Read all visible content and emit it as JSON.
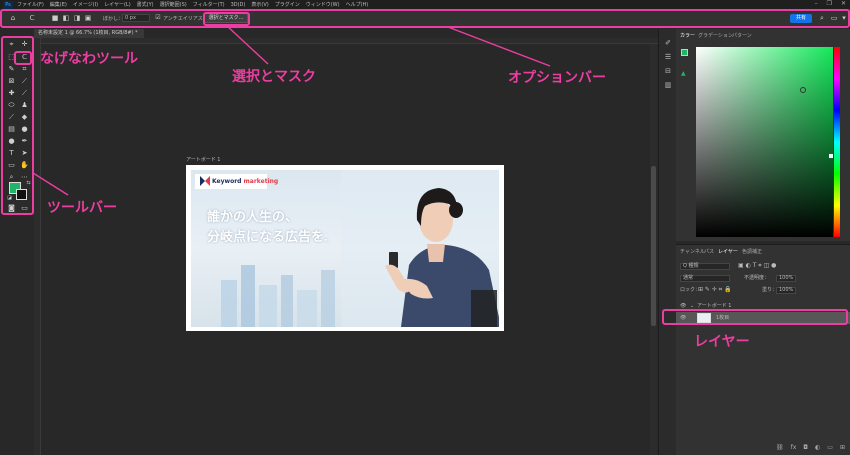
{
  "app": {
    "logo": "Ps"
  },
  "menu": {
    "items": [
      "ファイル(F)",
      "編集(E)",
      "イメージ(I)",
      "レイヤー(L)",
      "書式(Y)",
      "選択範囲(S)",
      "フィルター(T)",
      "3D(D)",
      "表示(V)",
      "プラグイン",
      "ウィンドウ(W)",
      "ヘルプ(H)"
    ],
    "window_controls": [
      "–",
      "❐",
      "✕"
    ]
  },
  "options": {
    "feather_label": "ぼかし：",
    "feather_value": "0 px",
    "antialias_label": "アンチエイリアス",
    "select_mask": "選択とマスク...",
    "share": "共有"
  },
  "document": {
    "tab_title": "名称未設定 1 @ 66.7% (1枚目, RGB/8#) *",
    "artboard_name": "アートボード 1"
  },
  "banner": {
    "brand_main": "Keyword ",
    "brand_accent": "marketing",
    "headline_line1": "誰かの人生の、",
    "headline_line2": "分岐点になる広告を",
    "headline_end": "。"
  },
  "color_panel": {
    "tabs": [
      "カラー",
      "グラデーション",
      "パターン"
    ],
    "accent": "#22b36b"
  },
  "layers_panel": {
    "tabs": [
      "チャンネル",
      "パス",
      "レイヤー",
      "色調補正"
    ],
    "active_tab": "レイヤー",
    "kind_filter": "Q 種類",
    "blend_mode": "通常",
    "opacity_label": "不透明度：",
    "opacity_value": "100%",
    "lock_label": "ロック：",
    "fill_label": "塗り：",
    "fill_value": "100%",
    "artboard_layer": "アートボード 1",
    "selected_layer": "1枚目"
  },
  "annotations": {
    "lasso": "なげなわツール",
    "select_mask": "選択とマスク",
    "options_bar": "オプションバー",
    "toolbar": "ツールバー",
    "layers": "レイヤー",
    "color": "#ec3ea0"
  }
}
